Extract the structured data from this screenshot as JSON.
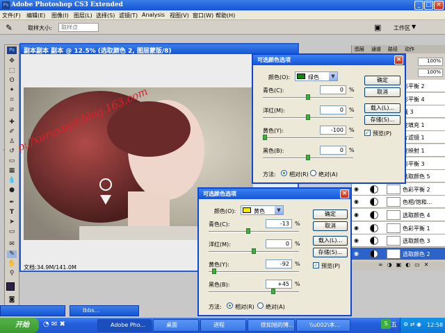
{
  "app": {
    "title": "Adobe Photoshop CS3 Extended",
    "logo": "Ps"
  },
  "menu": [
    "文件(F)",
    "编辑(E)",
    "图像(I)",
    "图层(L)",
    "选择(S)",
    "滤镜(T)",
    "Analysis",
    "视图(V)",
    "窗口(W)",
    "帮助(H)"
  ],
  "options": {
    "sample_label": "取样大小:",
    "sample_value": "取样点",
    "workspace_label": "工作区"
  },
  "document": {
    "title": "副本副本 副本 @ 12.5% (选取颜色 2, 图层蒙版/8)",
    "status": "文档:34.9M/141.0M"
  },
  "watermark": "http://xuruxuyd.blog.163.com",
  "dialog_green": {
    "title": "可选颜色选项",
    "color_label": "颜色(O):",
    "color_value": "绿色",
    "sliders": [
      {
        "label": "青色(C):",
        "value": "0",
        "level": 0
      },
      {
        "label": "洋红(M):",
        "value": "0",
        "level": 0
      },
      {
        "label": "黄色(Y):",
        "value": "-100",
        "level": -100
      },
      {
        "label": "黑色(B):",
        "value": "0",
        "level": 0
      }
    ],
    "unit": "%",
    "buttons": {
      "ok": "确定",
      "cancel": "取消",
      "load": "载入(L)...",
      "save": "存储(S)..."
    },
    "preview_label": "预览(P)",
    "method_label": "方法:",
    "method_relative": "相对(R)",
    "method_absolute": "绝对(A)"
  },
  "dialog_yellow": {
    "title": "可选颜色选项",
    "color_label": "颜色(O):",
    "color_value": "黄色",
    "sliders": [
      {
        "label": "青色(C):",
        "value": "-13",
        "level": -13
      },
      {
        "label": "洋红(M):",
        "value": "0",
        "level": 0
      },
      {
        "label": "黄色(Y):",
        "value": "-92",
        "level": -92
      },
      {
        "label": "黑色(B):",
        "value": "+45",
        "level": 45
      }
    ],
    "unit": "%",
    "buttons": {
      "ok": "确定",
      "cancel": "取消",
      "load": "载入(L)...",
      "save": "存储(S)..."
    },
    "preview_label": "预览(P)",
    "method_label": "方法:",
    "method_relative": "相对(R)",
    "method_absolute": "绝对(A)"
  },
  "layers_panel": {
    "tabs": [
      "图层",
      "通道",
      "路径",
      "动作"
    ],
    "opacity_label": "100%",
    "fill_label": "100%",
    "layers": [
      {
        "name": "彩平衡 2"
      },
      {
        "name": "彩平衡 4"
      },
      {
        "name": "线 3"
      },
      {
        "name": "变填充 1"
      },
      {
        "name": "片滤镜 1"
      },
      {
        "name": "变映射 1"
      },
      {
        "name": "彩平衡 3"
      },
      {
        "name": "选取颜色 5"
      },
      {
        "name": "色彩平衡 2"
      },
      {
        "name": "色相/饱和..."
      },
      {
        "name": "选取颜色 4"
      },
      {
        "name": "色彩平衡 1"
      },
      {
        "name": "选取颜色 3"
      },
      {
        "name": "选取颜色 2",
        "selected": true
      }
    ]
  },
  "taskbar": {
    "start": "开始",
    "tasks": [
      "Adobe Pho...",
      "桌面",
      "进程",
      "徐如旭的博...",
      "\\\\u002\\本...",
      "Ibbs..."
    ],
    "tray_time": "12:58",
    "ime_label": "五"
  },
  "colors": {
    "xp_blue": "#245edc",
    "accent_green": "#3fae3f",
    "selected_layer": "#2c63c9"
  }
}
